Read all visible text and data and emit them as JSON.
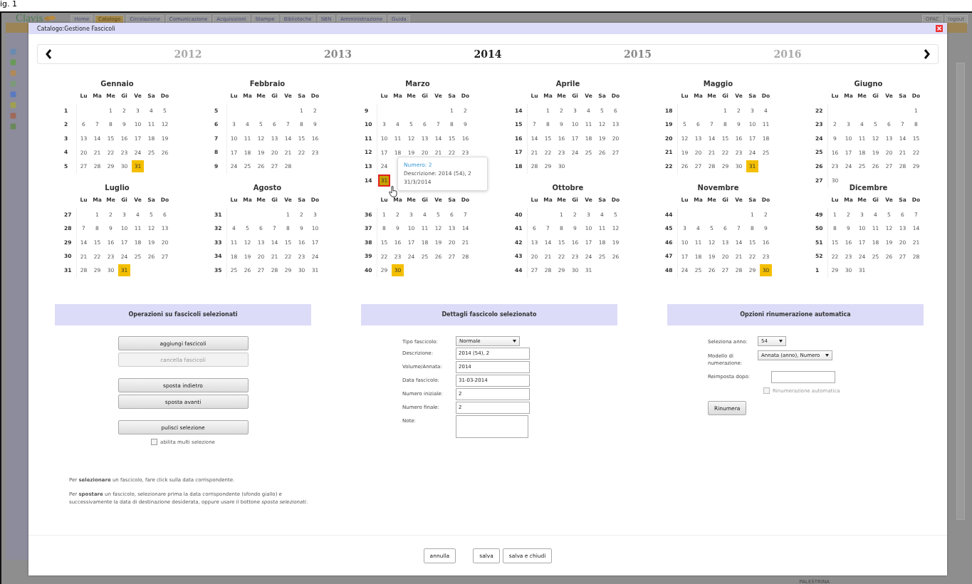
{
  "caption": "ig. 1",
  "background_app": {
    "logo": "Clavis",
    "tabs": [
      {
        "label": "Home",
        "selected": false
      },
      {
        "label": "Catalogo",
        "selected": true
      },
      {
        "label": "Circolazione",
        "selected": false
      },
      {
        "label": "Comunicazione",
        "selected": false
      },
      {
        "label": "Acquisizioni",
        "selected": false
      },
      {
        "label": "Stampe",
        "selected": false
      },
      {
        "label": "Biblioteche",
        "selected": false
      },
      {
        "label": "SBN",
        "selected": false
      },
      {
        "label": "Amministrazione",
        "selected": false
      },
      {
        "label": "Guida",
        "selected": false
      }
    ],
    "buttons": [
      "OPAC",
      "logout"
    ],
    "status": "PALESTRINA"
  },
  "dialog": {
    "title": "Catalogo:Gestione Fascicoli",
    "years": [
      {
        "label": "2012",
        "selected": false
      },
      {
        "label": "2013",
        "selected": false
      },
      {
        "label": "2014",
        "selected": true
      },
      {
        "label": "2015",
        "selected": false
      },
      {
        "label": "2016",
        "selected": false
      }
    ],
    "months": [
      {
        "name": "Gennaio",
        "weekdays": [
          "Lu",
          "Ma",
          "Me",
          "Gi",
          "Ve",
          "Sa",
          "Do"
        ],
        "weeks": [
          {
            "week": "1",
            "kind": "lead",
            "days": [
              "1",
              "2",
              "3",
              "4",
              "5"
            ]
          },
          {
            "week": "2",
            "days": [
              "6",
              "7",
              "8",
              "9",
              "10",
              "11",
              "12"
            ]
          },
          {
            "week": "3",
            "days": [
              "13",
              "14",
              "15",
              "16",
              "17",
              "18",
              "19"
            ]
          },
          {
            "week": "4",
            "days": [
              "20",
              "21",
              "22",
              "23",
              "24",
              "25",
              "26"
            ]
          },
          {
            "week": "5",
            "days": [
              "27",
              "28",
              "29",
              "30",
              {
                "day": "31",
                "kind": "issue",
                "selected": false
              }
            ]
          }
        ]
      },
      {
        "name": "Febbraio",
        "weekdays": [
          "Lu",
          "Ma",
          "Me",
          "Gi",
          "Ve",
          "Sa",
          "Do"
        ],
        "weeks": [
          {
            "week": "5",
            "kind": "lead",
            "days": [
              "1",
              "2"
            ]
          },
          {
            "week": "6",
            "days": [
              "3",
              "4",
              "5",
              "6",
              "7",
              "8",
              "9"
            ]
          },
          {
            "week": "7",
            "days": [
              "10",
              "11",
              "12",
              "13",
              "14",
              "15",
              "16"
            ]
          },
          {
            "week": "8",
            "days": [
              "17",
              "18",
              "19",
              "20",
              "21",
              "22",
              "23"
            ]
          },
          {
            "week": "9",
            "days": [
              "24",
              "25",
              "26",
              "27",
              "28"
            ]
          }
        ]
      },
      {
        "name": "Marzo",
        "weekdays": [
          "Lu",
          "Ma",
          "Me",
          "Gi",
          "Ve",
          "Sa",
          "Do"
        ],
        "weeks": [
          {
            "week": "9",
            "kind": "lead",
            "days": [
              "1",
              "2"
            ]
          },
          {
            "week": "10",
            "days": [
              "3",
              "4",
              "5",
              "6",
              "7",
              "8",
              "9"
            ]
          },
          {
            "week": "11",
            "days": [
              "10",
              "11",
              "12",
              "13",
              "14",
              "15",
              "16"
            ]
          },
          {
            "week": "12",
            "days": [
              "17",
              "18",
              "19",
              "20",
              "21",
              "22",
              "23"
            ]
          },
          {
            "week": "13",
            "days": [
              "24"
            ]
          },
          {
            "week": "14",
            "days": [
              {
                "day": "31",
                "kind": "issue",
                "selected": true
              }
            ]
          }
        ],
        "tooltip": {
          "number": "Numero: 2",
          "description": "Descrizione: 2014 (54), 2",
          "date": "31/3/2014"
        }
      },
      {
        "name": "Aprile",
        "weekdays": [
          "Lu",
          "Ma",
          "Me",
          "Gi",
          "Ve",
          "Sa",
          "Do"
        ],
        "weeks": [
          {
            "week": "14",
            "kind": "lead",
            "days": [
              "1",
              "2",
              "3",
              "4",
              "5",
              "6"
            ]
          },
          {
            "week": "15",
            "days": [
              "7",
              "8",
              "9",
              "10",
              "11",
              "12",
              "13"
            ]
          },
          {
            "week": "16",
            "days": [
              "14",
              "15",
              "16",
              "17",
              "18",
              "19",
              "20"
            ]
          },
          {
            "week": "17",
            "days": [
              "21",
              "22",
              "23",
              "24",
              "25",
              "26",
              "27"
            ]
          },
          {
            "week": "18",
            "days": [
              "28",
              "29",
              "30"
            ]
          }
        ]
      },
      {
        "name": "Maggio",
        "weekdays": [
          "Lu",
          "Ma",
          "Me",
          "Gi",
          "Ve",
          "Sa",
          "Do"
        ],
        "weeks": [
          {
            "week": "18",
            "kind": "lead",
            "days": [
              "1",
              "2",
              "3",
              "4"
            ]
          },
          {
            "week": "19",
            "days": [
              "5",
              "6",
              "7",
              "8",
              "9",
              "10",
              "11"
            ]
          },
          {
            "week": "20",
            "days": [
              "12",
              "13",
              "14",
              "15",
              "16",
              "17",
              "18"
            ]
          },
          {
            "week": "21",
            "days": [
              "19",
              "20",
              "21",
              "22",
              "23",
              "24",
              "25"
            ]
          },
          {
            "week": "22",
            "days": [
              "26",
              "27",
              "28",
              "29",
              "30",
              {
                "day": "31",
                "kind": "issue",
                "selected": false
              }
            ]
          }
        ]
      },
      {
        "name": "Giugno",
        "weekdays": [
          "Lu",
          "Ma",
          "Me",
          "Gi",
          "Ve",
          "Sa",
          "Do"
        ],
        "weeks": [
          {
            "week": "22",
            "kind": "lead",
            "days": [
              "1"
            ]
          },
          {
            "week": "23",
            "days": [
              "2",
              "3",
              "4",
              "5",
              "6",
              "7",
              "8"
            ]
          },
          {
            "week": "24",
            "days": [
              "9",
              "10",
              "11",
              "12",
              "13",
              "14",
              "15"
            ]
          },
          {
            "week": "25",
            "days": [
              "16",
              "17",
              "18",
              "19",
              "20",
              "21",
              "22"
            ]
          },
          {
            "week": "26",
            "days": [
              "23",
              "24",
              "25",
              "26",
              "27",
              "28",
              "29"
            ]
          },
          {
            "week": "27",
            "days": [
              "30"
            ]
          }
        ]
      },
      {
        "name": "Luglio",
        "weekdays": [
          "Lu",
          "Ma",
          "Me",
          "Gi",
          "Ve",
          "Sa",
          "Do"
        ],
        "weeks": [
          {
            "week": "27",
            "kind": "lead",
            "days": [
              "1",
              "2",
              "3",
              "4",
              "5",
              "6"
            ]
          },
          {
            "week": "28",
            "days": [
              "7",
              "8",
              "9",
              "10",
              "11",
              "12",
              "13"
            ]
          },
          {
            "week": "29",
            "days": [
              "14",
              "15",
              "16",
              "17",
              "18",
              "19",
              "20"
            ]
          },
          {
            "week": "30",
            "days": [
              "21",
              "22",
              "23",
              "24",
              "25",
              "26",
              "27"
            ]
          },
          {
            "week": "31",
            "days": [
              "28",
              "29",
              "30",
              {
                "day": "31",
                "kind": "issue",
                "selected": false
              }
            ]
          }
        ]
      },
      {
        "name": "Agosto",
        "weekdays": [
          "Lu",
          "Ma",
          "Me",
          "Gi",
          "Ve",
          "Sa",
          "Do"
        ],
        "weeks": [
          {
            "week": "31",
            "kind": "lead",
            "days": [
              "1",
              "2",
              "3"
            ]
          },
          {
            "week": "32",
            "days": [
              "4",
              "5",
              "6",
              "7",
              "8",
              "9",
              "10"
            ]
          },
          {
            "week": "33",
            "days": [
              "11",
              "12",
              "13",
              "14",
              "15",
              "16",
              "17"
            ]
          },
          {
            "week": "34",
            "days": [
              "18",
              "19",
              "20",
              "21",
              "22",
              "23",
              "24"
            ]
          },
          {
            "week": "35",
            "days": [
              "25",
              "26",
              "27",
              "28",
              "29",
              "30",
              "31"
            ]
          }
        ]
      },
      {
        "weekdays": [
          "Lu",
          "Ma",
          "Me",
          "Gi",
          "Ve",
          "Sa",
          "Do"
        ],
        "weeks": [
          {
            "week": "36",
            "days": [
              "1",
              "2",
              "3",
              "4",
              "5",
              "6",
              "7"
            ]
          },
          {
            "week": "37",
            "days": [
              "8",
              "9",
              "10",
              "11",
              "12",
              "13",
              "14"
            ]
          },
          {
            "week": "38",
            "days": [
              "15",
              "16",
              "17",
              "18",
              "19",
              "20",
              "21"
            ]
          },
          {
            "week": "39",
            "days": [
              "22",
              "23",
              "24",
              "25",
              "26",
              "27",
              "28"
            ]
          },
          {
            "week": "40",
            "days": [
              "29",
              {
                "day": "30",
                "kind": "issue",
                "selected": false
              }
            ]
          }
        ]
      },
      {
        "name": "Ottobre",
        "weekdays": [
          "Lu",
          "Ma",
          "Me",
          "Gi",
          "Ve",
          "Sa",
          "Do"
        ],
        "weeks": [
          {
            "week": "40",
            "kind": "lead",
            "days": [
              "1",
              "2",
              "3",
              "4",
              "5"
            ]
          },
          {
            "week": "41",
            "days": [
              "6",
              "7",
              "8",
              "9",
              "10",
              "11",
              "12"
            ]
          },
          {
            "week": "42",
            "days": [
              "13",
              "14",
              "15",
              "16",
              "17",
              "18",
              "19"
            ]
          },
          {
            "week": "43",
            "days": [
              "20",
              "21",
              "22",
              "23",
              "24",
              "25",
              "26"
            ]
          },
          {
            "week": "44",
            "days": [
              "27",
              "28",
              "29",
              "30",
              "31"
            ]
          }
        ]
      },
      {
        "name": "Novembre",
        "weekdays": [
          "Lu",
          "Ma",
          "Me",
          "Gi",
          "Ve",
          "Sa",
          "Do"
        ],
        "weeks": [
          {
            "week": "44",
            "kind": "lead",
            "days": [
              "1",
              "2"
            ]
          },
          {
            "week": "45",
            "days": [
              "3",
              "4",
              "5",
              "6",
              "7",
              "8",
              "9"
            ]
          },
          {
            "week": "46",
            "days": [
              "10",
              "11",
              "12",
              "13",
              "14",
              "15",
              "16"
            ]
          },
          {
            "week": "47",
            "days": [
              "17",
              "18",
              "19",
              "20",
              "21",
              "22",
              "23"
            ]
          },
          {
            "week": "48",
            "days": [
              "24",
              "25",
              "26",
              "27",
              "28",
              "29",
              {
                "day": "30",
                "kind": "issue",
                "selected": false
              }
            ]
          }
        ]
      },
      {
        "name": "Dicembre",
        "weekdays": [
          "Lu",
          "Ma",
          "Me",
          "Gi",
          "Ve",
          "Sa",
          "Do"
        ],
        "weeks": [
          {
            "week": "49",
            "days": [
              "1",
              "2",
              "3",
              "4",
              "5",
              "6",
              "7"
            ]
          },
          {
            "week": "50",
            "days": [
              "8",
              "9",
              "10",
              "11",
              "12",
              "13",
              "14"
            ]
          },
          {
            "week": "51",
            "days": [
              "15",
              "16",
              "17",
              "18",
              "19",
              "20",
              "21"
            ]
          },
          {
            "week": "52",
            "days": [
              "22",
              "23",
              "24",
              "25",
              "26",
              "27",
              "28"
            ]
          },
          {
            "week": "1",
            "days": [
              "29",
              "30",
              "31"
            ]
          }
        ]
      }
    ],
    "operations": {
      "title": "Operazioni su fascicoli selezionati",
      "button_groups": [
        [
          {
            "label": "aggiungi fascicoli",
            "disabled": false
          },
          {
            "label": "cancella fascicoli",
            "disabled": true
          }
        ],
        [
          {
            "label": "sposta indietro",
            "disabled": false
          },
          {
            "label": "sposta avanti",
            "disabled": false
          }
        ],
        [
          {
            "label": "pulisci selezione",
            "disabled": false
          }
        ]
      ],
      "checkbox": {
        "label": "abilita multi selezione",
        "checked": false
      },
      "help": [
        "Per **selezionare** un fascicolo, fare click sulla data corrispondente.",
        "Per **spostare** un fascicolo, selezionare prima la data corrispondente (sfondo giallo) e successivamente la data di destinazione desiderata, oppure usare il bottone *sposta selezionati*."
      ]
    },
    "details": {
      "title": "Dettagli fascicolo selezionato",
      "fields": [
        {
          "label": "Tipo fascicolo:",
          "kind": "select",
          "value": "Normale"
        },
        {
          "label": "Descrizione:",
          "kind": "input",
          "value": "2014 (54), 2"
        },
        {
          "label": "Volume/Annata:",
          "kind": "input",
          "value": "2014"
        },
        {
          "label": "Data fascicolo:",
          "kind": "input",
          "value": "31-03-2014"
        },
        {
          "label": "Numero iniziale:",
          "kind": "input",
          "value": "2"
        },
        {
          "label": "Numero finale:",
          "kind": "input",
          "value": "2"
        },
        {
          "label": "Note:",
          "kind": "textarea"
        }
      ]
    },
    "renumbering": {
      "title": "Opzioni rinumerazione automatica",
      "fields": [
        {
          "label": "Seleziona anno:",
          "kind": "select",
          "value": "54"
        },
        {
          "label": "Modello di numerazione:",
          "kind": "select",
          "value": "Annata (anno), Numero"
        },
        {
          "label": "Reimposta dopo:",
          "kind": "input"
        }
      ],
      "checkbox": {
        "label": "Rinumerazione automatica",
        "checked": false,
        "disabled": true
      },
      "button": "Rinumera"
    },
    "footer_groups": [
      [
        "annulla"
      ],
      [
        "salva",
        "salva e chiudi"
      ]
    ]
  }
}
